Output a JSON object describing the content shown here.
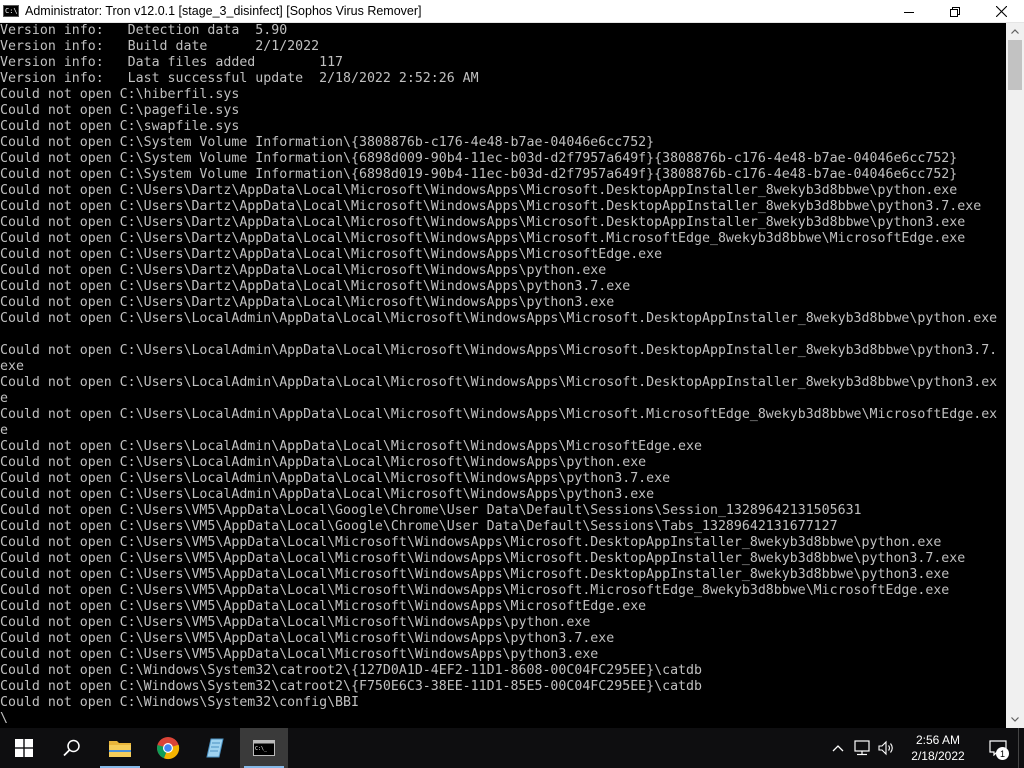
{
  "window": {
    "title": "Administrator:  Tron v12.0.1 [stage_3_disinfect] [Sophos Virus Remover]",
    "icon_label": "C:\\",
    "controls": [
      "minimize-icon",
      "maximize-icon",
      "close-icon"
    ]
  },
  "console": {
    "lines": [
      "Version info:   Detection data  5.90",
      "Version info:   Build date      2/1/2022",
      "Version info:   Data files added        117",
      "Version info:   Last successful update  2/18/2022 2:52:26 AM",
      "Could not open C:\\hiberfil.sys",
      "Could not open C:\\pagefile.sys",
      "Could not open C:\\swapfile.sys",
      "Could not open C:\\System Volume Information\\{3808876b-c176-4e48-b7ae-04046e6cc752}",
      "Could not open C:\\System Volume Information\\{6898d009-90b4-11ec-b03d-d2f7957a649f}{3808876b-c176-4e48-b7ae-04046e6cc752}",
      "Could not open C:\\System Volume Information\\{6898d019-90b4-11ec-b03d-d2f7957a649f}{3808876b-c176-4e48-b7ae-04046e6cc752}",
      "Could not open C:\\Users\\Dartz\\AppData\\Local\\Microsoft\\WindowsApps\\Microsoft.DesktopAppInstaller_8wekyb3d8bbwe\\python.exe",
      "Could not open C:\\Users\\Dartz\\AppData\\Local\\Microsoft\\WindowsApps\\Microsoft.DesktopAppInstaller_8wekyb3d8bbwe\\python3.7.exe",
      "Could not open C:\\Users\\Dartz\\AppData\\Local\\Microsoft\\WindowsApps\\Microsoft.DesktopAppInstaller_8wekyb3d8bbwe\\python3.exe",
      "Could not open C:\\Users\\Dartz\\AppData\\Local\\Microsoft\\WindowsApps\\Microsoft.MicrosoftEdge_8wekyb3d8bbwe\\MicrosoftEdge.exe",
      "Could not open C:\\Users\\Dartz\\AppData\\Local\\Microsoft\\WindowsApps\\MicrosoftEdge.exe",
      "Could not open C:\\Users\\Dartz\\AppData\\Local\\Microsoft\\WindowsApps\\python.exe",
      "Could not open C:\\Users\\Dartz\\AppData\\Local\\Microsoft\\WindowsApps\\python3.7.exe",
      "Could not open C:\\Users\\Dartz\\AppData\\Local\\Microsoft\\WindowsApps\\python3.exe",
      "Could not open C:\\Users\\LocalAdmin\\AppData\\Local\\Microsoft\\WindowsApps\\Microsoft.DesktopAppInstaller_8wekyb3d8bbwe\\python.exe",
      "",
      "Could not open C:\\Users\\LocalAdmin\\AppData\\Local\\Microsoft\\WindowsApps\\Microsoft.DesktopAppInstaller_8wekyb3d8bbwe\\python3.7.",
      "exe",
      "Could not open C:\\Users\\LocalAdmin\\AppData\\Local\\Microsoft\\WindowsApps\\Microsoft.DesktopAppInstaller_8wekyb3d8bbwe\\python3.ex",
      "e",
      "Could not open C:\\Users\\LocalAdmin\\AppData\\Local\\Microsoft\\WindowsApps\\Microsoft.MicrosoftEdge_8wekyb3d8bbwe\\MicrosoftEdge.ex",
      "e",
      "Could not open C:\\Users\\LocalAdmin\\AppData\\Local\\Microsoft\\WindowsApps\\MicrosoftEdge.exe",
      "Could not open C:\\Users\\LocalAdmin\\AppData\\Local\\Microsoft\\WindowsApps\\python.exe",
      "Could not open C:\\Users\\LocalAdmin\\AppData\\Local\\Microsoft\\WindowsApps\\python3.7.exe",
      "Could not open C:\\Users\\LocalAdmin\\AppData\\Local\\Microsoft\\WindowsApps\\python3.exe",
      "Could not open C:\\Users\\VM5\\AppData\\Local\\Google\\Chrome\\User Data\\Default\\Sessions\\Session_13289642131505631",
      "Could not open C:\\Users\\VM5\\AppData\\Local\\Google\\Chrome\\User Data\\Default\\Sessions\\Tabs_13289642131677127",
      "Could not open C:\\Users\\VM5\\AppData\\Local\\Microsoft\\WindowsApps\\Microsoft.DesktopAppInstaller_8wekyb3d8bbwe\\python.exe",
      "Could not open C:\\Users\\VM5\\AppData\\Local\\Microsoft\\WindowsApps\\Microsoft.DesktopAppInstaller_8wekyb3d8bbwe\\python3.7.exe",
      "Could not open C:\\Users\\VM5\\AppData\\Local\\Microsoft\\WindowsApps\\Microsoft.DesktopAppInstaller_8wekyb3d8bbwe\\python3.exe",
      "Could not open C:\\Users\\VM5\\AppData\\Local\\Microsoft\\WindowsApps\\Microsoft.MicrosoftEdge_8wekyb3d8bbwe\\MicrosoftEdge.exe",
      "Could not open C:\\Users\\VM5\\AppData\\Local\\Microsoft\\WindowsApps\\MicrosoftEdge.exe",
      "Could not open C:\\Users\\VM5\\AppData\\Local\\Microsoft\\WindowsApps\\python.exe",
      "Could not open C:\\Users\\VM5\\AppData\\Local\\Microsoft\\WindowsApps\\python3.7.exe",
      "Could not open C:\\Users\\VM5\\AppData\\Local\\Microsoft\\WindowsApps\\python3.exe",
      "Could not open C:\\Windows\\System32\\catroot2\\{127D0A1D-4EF2-11D1-8608-00C04FC295EE}\\catdb",
      "Could not open C:\\Windows\\System32\\catroot2\\{F750E6C3-38EE-11D1-85E5-00C04FC295EE}\\catdb",
      "Could not open C:\\Windows\\System32\\config\\BBI",
      "\\"
    ]
  },
  "taskbar": {
    "apps": [
      {
        "name": "start-button",
        "icon": "windows-logo-icon"
      },
      {
        "name": "search-button",
        "icon": "search-icon"
      },
      {
        "name": "file-explorer-button",
        "icon": "folder-icon"
      },
      {
        "name": "chrome-button",
        "icon": "chrome-icon"
      },
      {
        "name": "notepad-button",
        "icon": "notepad-icon"
      },
      {
        "name": "cmd-button",
        "icon": "cmd-icon"
      }
    ],
    "clock_time": "2:56 AM",
    "clock_date": "2/18/2022",
    "notification_count": "1",
    "colors": {
      "taskbar_bg": "#0e0e10",
      "running_indicator": "#86b9e8"
    }
  }
}
